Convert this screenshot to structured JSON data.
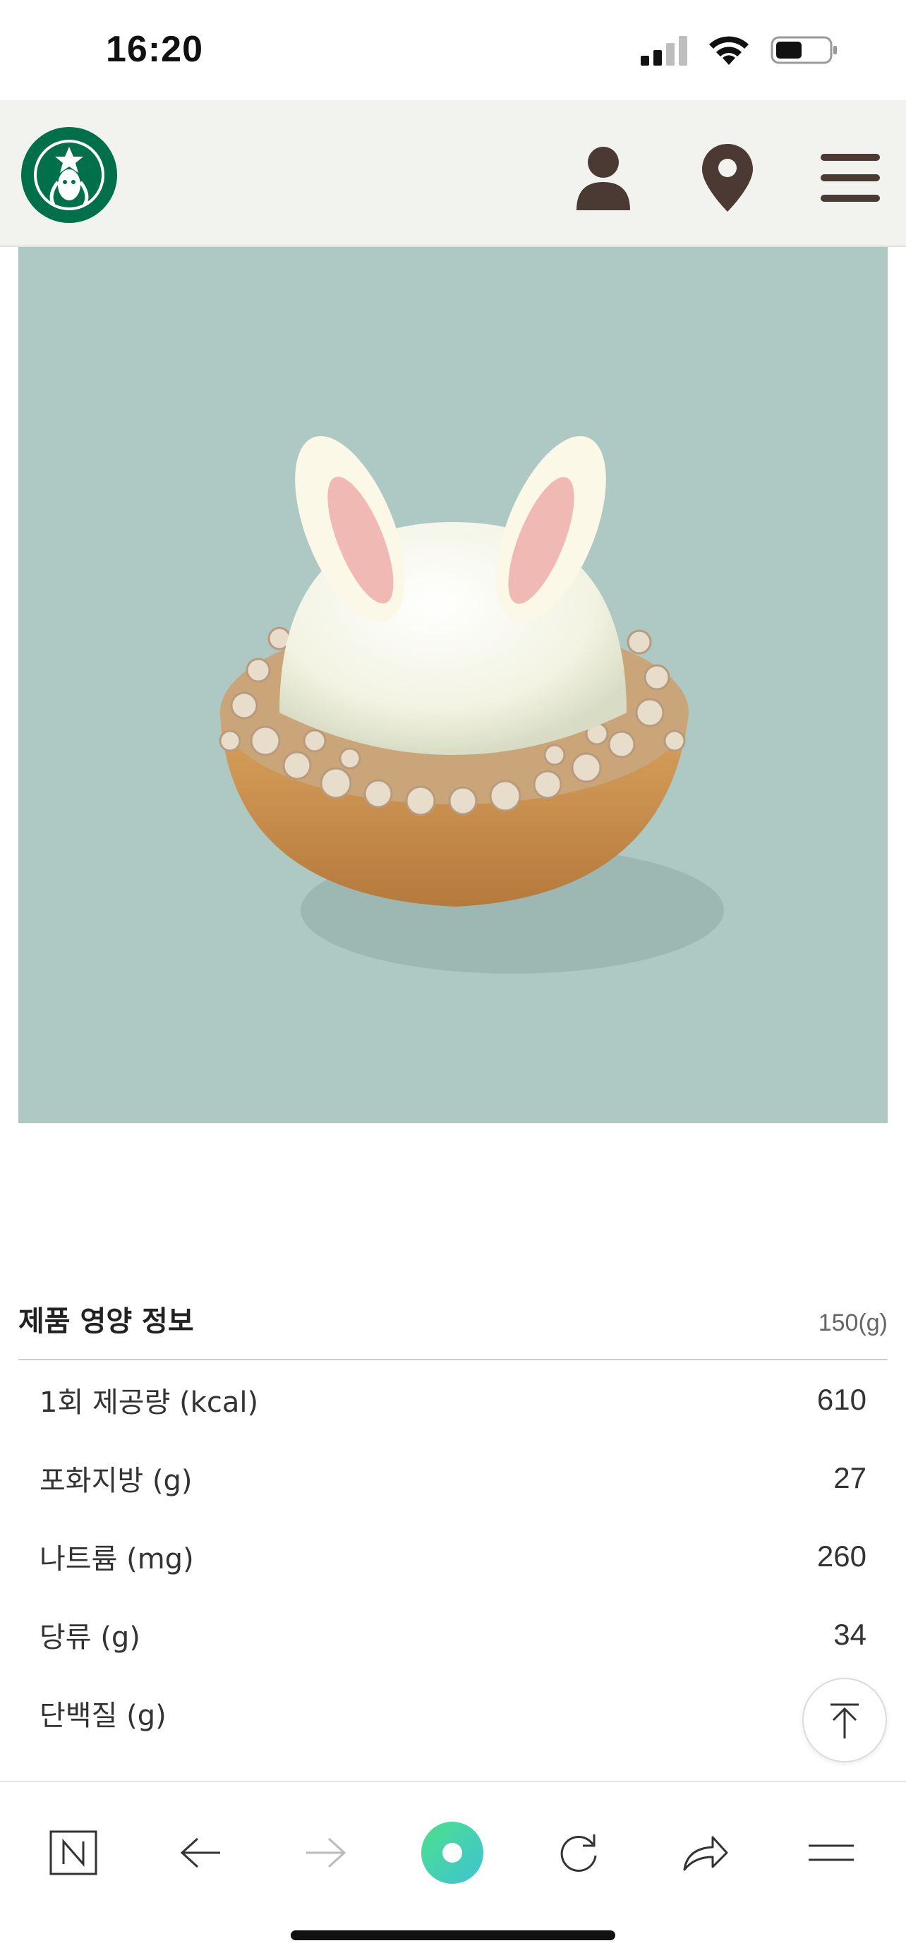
{
  "status_bar": {
    "time": "16:20"
  },
  "header": {
    "logo_icon": "starbucks-siren-logo",
    "icons": [
      "person-icon",
      "location-pin-icon",
      "hamburger-menu-icon"
    ]
  },
  "hero": {
    "image_subject": "bunny-ear-tart-image"
  },
  "nutrition": {
    "title": "제품 영양 정보",
    "weight": "150(g)",
    "rows": [
      {
        "label": "1회 제공량 (kcal)",
        "value": "610"
      },
      {
        "label": "포화지방 (g)",
        "value": "27"
      },
      {
        "label": "나트륨 (mg)",
        "value": "260"
      },
      {
        "label": "당류 (g)",
        "value": "34"
      },
      {
        "label": "단백질 (g)",
        "value": ""
      }
    ]
  },
  "browser_bar": {
    "icons": [
      "naver-icon",
      "back-arrow-icon",
      "forward-arrow-icon",
      "green-dot-icon",
      "refresh-icon",
      "share-icon",
      "menu-icon"
    ]
  },
  "colors": {
    "header_bg": "#f2f3ee",
    "icon_brown": "#4a3a33",
    "starbucks_green": "#00704a",
    "hero_bg": "#aec8c4"
  }
}
